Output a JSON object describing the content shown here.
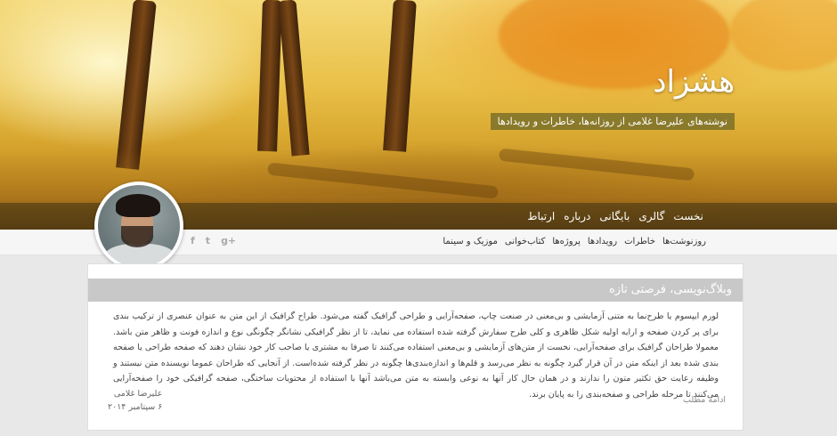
{
  "site": {
    "title": "هشزاد",
    "tagline": "نوشته‌های علیرضا غلامی از روزانه‌ها، خاطرات و رویدادها"
  },
  "main_nav": [
    "نخست",
    "گالری",
    "بایگانی",
    "درباره",
    "ارتباط"
  ],
  "sub_nav": [
    "روزنوشت‌ها",
    "خاطرات",
    "رویدادها",
    "پروژه‌ها",
    "کتاب‌خوانی",
    "موزیک و سینما"
  ],
  "social": {
    "facebook": "f",
    "twitter": "t",
    "google_plus": "g+"
  },
  "post": {
    "title": "وبلاگ‌نویسی، فرصتی تازه",
    "body": "لورم ایپسوم یا طرح‌نما به متنی آزمایشی و بی‌معنی در صنعت چاپ، صفحه‌آرایی و طراحی گرافیک گفته می‌شود. طراح گرافیک از این متن به عنوان عنصری از ترکیب بندی برای پر کردن صفحه و ارایه اولیه شکل ظاهری و کلی طرح سفارش گرفته شده استفاده می نماید، تا از نظر گرافیکی نشانگر چگونگی نوع و اندازه فونت و ظاهر متن باشد. معمولا طراحان گرافیک برای صفحه‌آرایی، نخست از متن‌های آزمایشی و بی‌معنی استفاده می‌کنند تا صرفا به مشتری یا صاحب کار خود نشان دهند که صفحه طراحی یا صفحه بندی شده بعد از اینکه متن در آن قرار گیرد چگونه به نظر می‌رسد و قلم‌ها و اندازه‌بندی‌ها چگونه در نظر گرفته شده‌است. از آنجایی که طراحان عموما نویسنده متن نیستند و وظیفه رعایت حق تکثیر متون را ندارند و در همان حال کار آنها به نوعی وابسته به متن می‌باشد آنها با استفاده از محتویات ساختگی، صفحه گرافیکی خود را صفحه‌آرایی می‌کنند تا مرحله طراحی و صفحه‌بندی را به پایان برند.",
    "author": "علیرضا غلامی",
    "date": "۶ سپتامبر ۲۰۱۴",
    "read_more": "ادامه مطلب"
  }
}
